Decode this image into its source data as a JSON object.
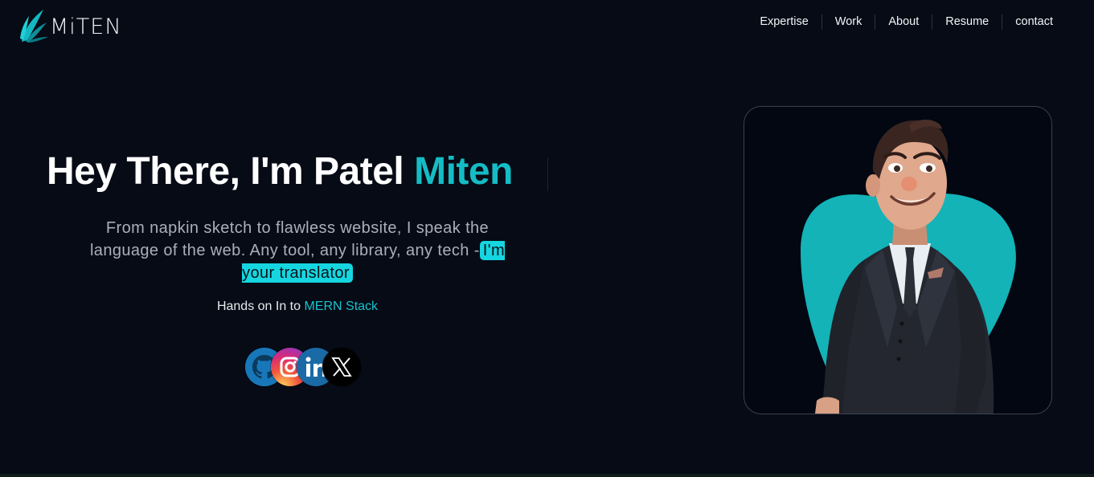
{
  "brand": {
    "name": "MiTEN"
  },
  "nav": {
    "items": [
      {
        "label": "Expertise"
      },
      {
        "label": "Work"
      },
      {
        "label": "About"
      },
      {
        "label": "Resume"
      },
      {
        "label": "contact"
      }
    ]
  },
  "hero": {
    "title_prefix": "Hey There, I'm Patel ",
    "title_accent": "Miten",
    "tagline": "From napkin sketch to flawless website, I speak the language of the web. Any tool, any library, any tech -",
    "tagline_highlight": "I'm your translator",
    "stack_prefix": "Hands on In to ",
    "stack_accent": "MERN Stack"
  },
  "socials": [
    {
      "icon": "github-icon"
    },
    {
      "icon": "instagram-icon"
    },
    {
      "icon": "linkedin-icon"
    },
    {
      "icon": "x-icon"
    }
  ],
  "colors": {
    "background": "#060b16",
    "accent": "#15bcc4",
    "highlight": "#15d6e0"
  }
}
